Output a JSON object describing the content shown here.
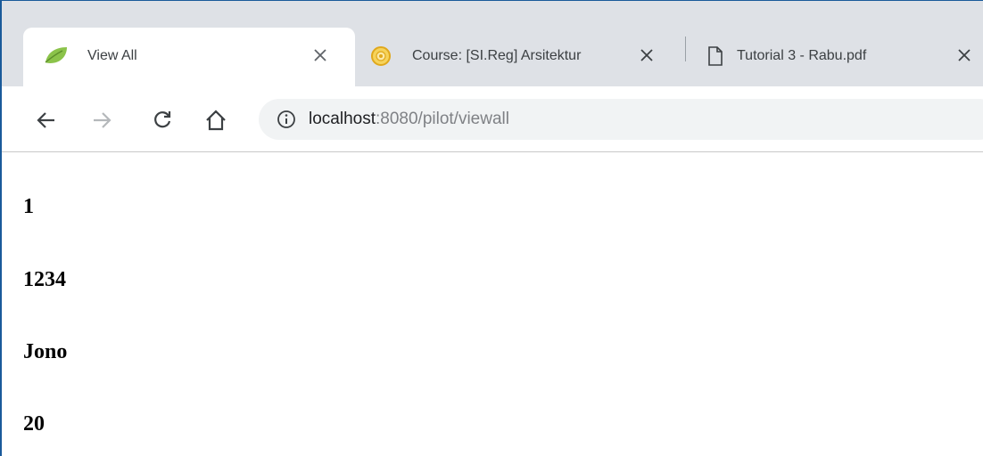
{
  "browser": {
    "tabs": [
      {
        "title": "View All",
        "favicon": "leaf-icon",
        "active": true
      },
      {
        "title": "Course: [SI.Reg] Arsitektur",
        "favicon": "university-seal-icon",
        "active": false
      },
      {
        "title": "Tutorial 3 - Rabu.pdf",
        "favicon": "document-icon",
        "active": false
      }
    ],
    "address_bar": {
      "host": "localhost",
      "rest": ":8080/pilot/viewall"
    }
  },
  "page": {
    "fields": [
      "1",
      "1234",
      "Jono",
      "20"
    ]
  },
  "colors": {
    "tabstrip_bg": "#dee1e6",
    "omnibox_bg": "#f1f3f4",
    "leaf_green": "#8bc34a",
    "seal_gold": "#f2c12e"
  }
}
